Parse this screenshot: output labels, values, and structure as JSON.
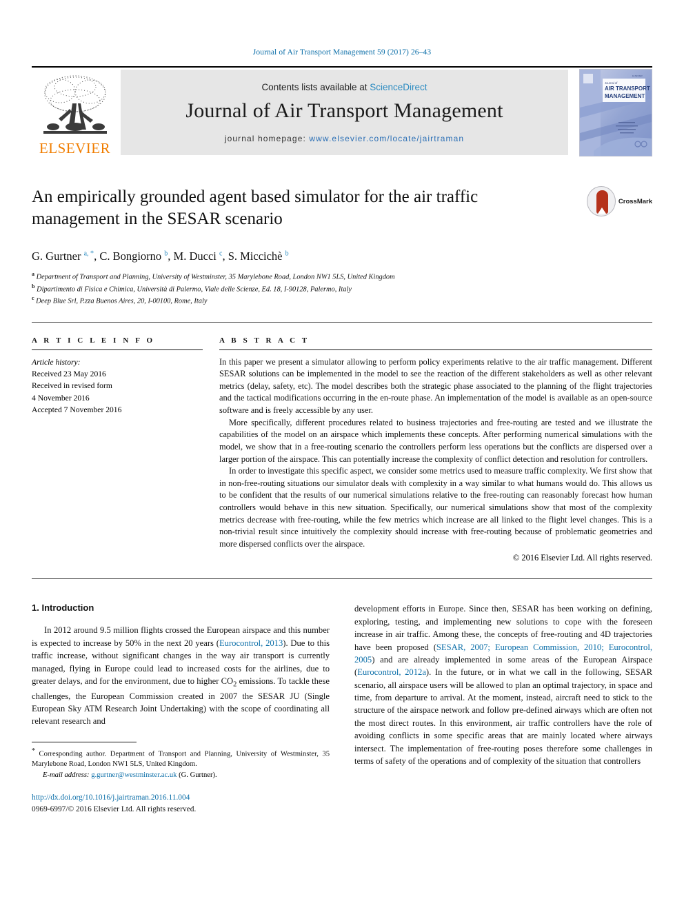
{
  "running_head": "Journal of Air Transport Management 59 (2017) 26–43",
  "masthead": {
    "publisher_name": "ELSEVIER",
    "contents_prefix": "Contents lists available at ",
    "contents_link": "ScienceDirect",
    "journal_title": "Journal of Air Transport Management",
    "homepage_prefix": "journal homepage: ",
    "homepage_url": "www.elsevier.com/locate/jairtraman",
    "cover_title_small": "Journal of",
    "cover_title_line1": "AIR TRANSPORT",
    "cover_title_line2": "MANAGEMENT"
  },
  "article": {
    "title": "An empirically grounded agent based simulator for the air traffic management in the SESAR scenario",
    "crossmark_label": "CrossMark",
    "authors_html": "G. Gurtner <sup>a, *</sup>, C. Bongiorno <sup>b</sup>, M. Ducci <sup>c</sup>, S. Miccichè <sup>b</sup>",
    "affiliations": [
      {
        "marker": "a",
        "text": "Department of Transport and Planning, University of Westminster, 35 Marylebone Road, London NW1 5LS, United Kingdom"
      },
      {
        "marker": "b",
        "text": "Dipartimento di Fisica e Chimica, Università di Palermo, Viale delle Scienze, Ed. 18, I-90128, Palermo, Italy"
      },
      {
        "marker": "c",
        "text": "Deep Blue Srl, P.zza Buenos Aires, 20, I-00100, Rome, Italy"
      }
    ]
  },
  "article_info": {
    "heading": "A R T I C L E  I N F O",
    "history_label": "Article history:",
    "history_lines": [
      "Received 23 May 2016",
      "Received in revised form",
      "4 November 2016",
      "Accepted 7 November 2016"
    ]
  },
  "abstract": {
    "heading": "A B S T R A C T",
    "paragraphs": [
      "In this paper we present a simulator allowing to perform policy experiments relative to the air traffic management. Different SESAR solutions can be implemented in the model to see the reaction of the different stakeholders as well as other relevant metrics (delay, safety, etc). The model describes both the strategic phase associated to the planning of the flight trajectories and the tactical modifications occurring in the en-route phase. An implementation of the model is available as an open-source software and is freely accessible by any user.",
      "More specifically, different procedures related to business trajectories and free-routing are tested and we illustrate the capabilities of the model on an airspace which implements these concepts. After performing numerical simulations with the model, we show that in a free-routing scenario the controllers perform less operations but the conflicts are dispersed over a larger portion of the airspace. This can potentially increase the complexity of conflict detection and resolution for controllers.",
      "In order to investigate this specific aspect, we consider some metrics used to measure traffic complexity. We first show that in non-free-routing situations our simulator deals with complexity in a way similar to what humans would do. This allows us to be confident that the results of our numerical simulations relative to the free-routing can reasonably forecast how human controllers would behave in this new situation. Specifically, our numerical simulations show that most of the complexity metrics decrease with free-routing, while the few metrics which increase are all linked to the flight level changes. This is a non-trivial result since intuitively the complexity should increase with free-routing because of problematic geometries and more dispersed conflicts over the airspace."
    ],
    "copyright": "© 2016 Elsevier Ltd. All rights reserved."
  },
  "body": {
    "section_heading": "1. Introduction",
    "left_paragraph_html": "In 2012 around 9.5 million flights crossed the European airspace and this number is expected to increase by 50% in the next 20 years (<span class=\"ref\">Eurocontrol, 2013</span>). Due to this traffic increase, without significant changes in the way air transport is currently managed, flying in Europe could lead to increased costs for the airlines, due to greater delays, and for the environment, due to higher CO<sub>2</sub> emissions. To tackle these challenges, the European Commission created in 2007 the SESAR JU (Single European Sky ATM Research Joint Undertaking) with the scope of coordinating all relevant research and",
    "right_paragraph_html": "development efforts in Europe. Since then, SESAR has been working on defining, exploring, testing, and implementing new solutions to cope with the foreseen increase in air traffic. Among these, the concepts of free-routing and 4D trajectories have been proposed (<span class=\"ref\">SESAR, 2007; European Commission, 2010; Eurocontrol, 2005</span>) and are already implemented in some areas of the European Airspace (<span class=\"ref\">Eurocontrol, 2012a</span>). In the future, or in what we call in the following, SESAR scenario, all airspace users will be allowed to plan an optimal trajectory, in space and time, from departure to arrival. At the moment, instead, aircraft need to stick to the structure of the airspace network and follow pre-defined airways which are often not the most direct routes. In this environment, air traffic controllers have the role of avoiding conflicts in some specific areas that are mainly located where airways intersect. The implementation of free-routing poses therefore some challenges in terms of safety of the operations and of complexity of the situation that controllers"
  },
  "footnote": {
    "corresponding_html": "<span class=\"fn-star\">*</span> Corresponding author. Department of Transport and Planning, University of Westminster, 35 Marylebone Road, London NW1 5LS, United Kingdom.",
    "email_label": "E-mail address:",
    "email": "g.gurtner@westminster.ac.uk",
    "email_owner": "(G. Gurtner).",
    "doi": "http://dx.doi.org/10.1016/j.jairtraman.2016.11.004",
    "issn_line": "0969-6997/© 2016 Elsevier Ltd. All rights reserved."
  },
  "colors": {
    "link_blue": "#0b6ea8",
    "science_direct_blue": "#2b8bc1",
    "elsevier_orange": "#f07d00",
    "crossmark_red": "#b5321b",
    "band_gray": "#e6e6e6"
  }
}
